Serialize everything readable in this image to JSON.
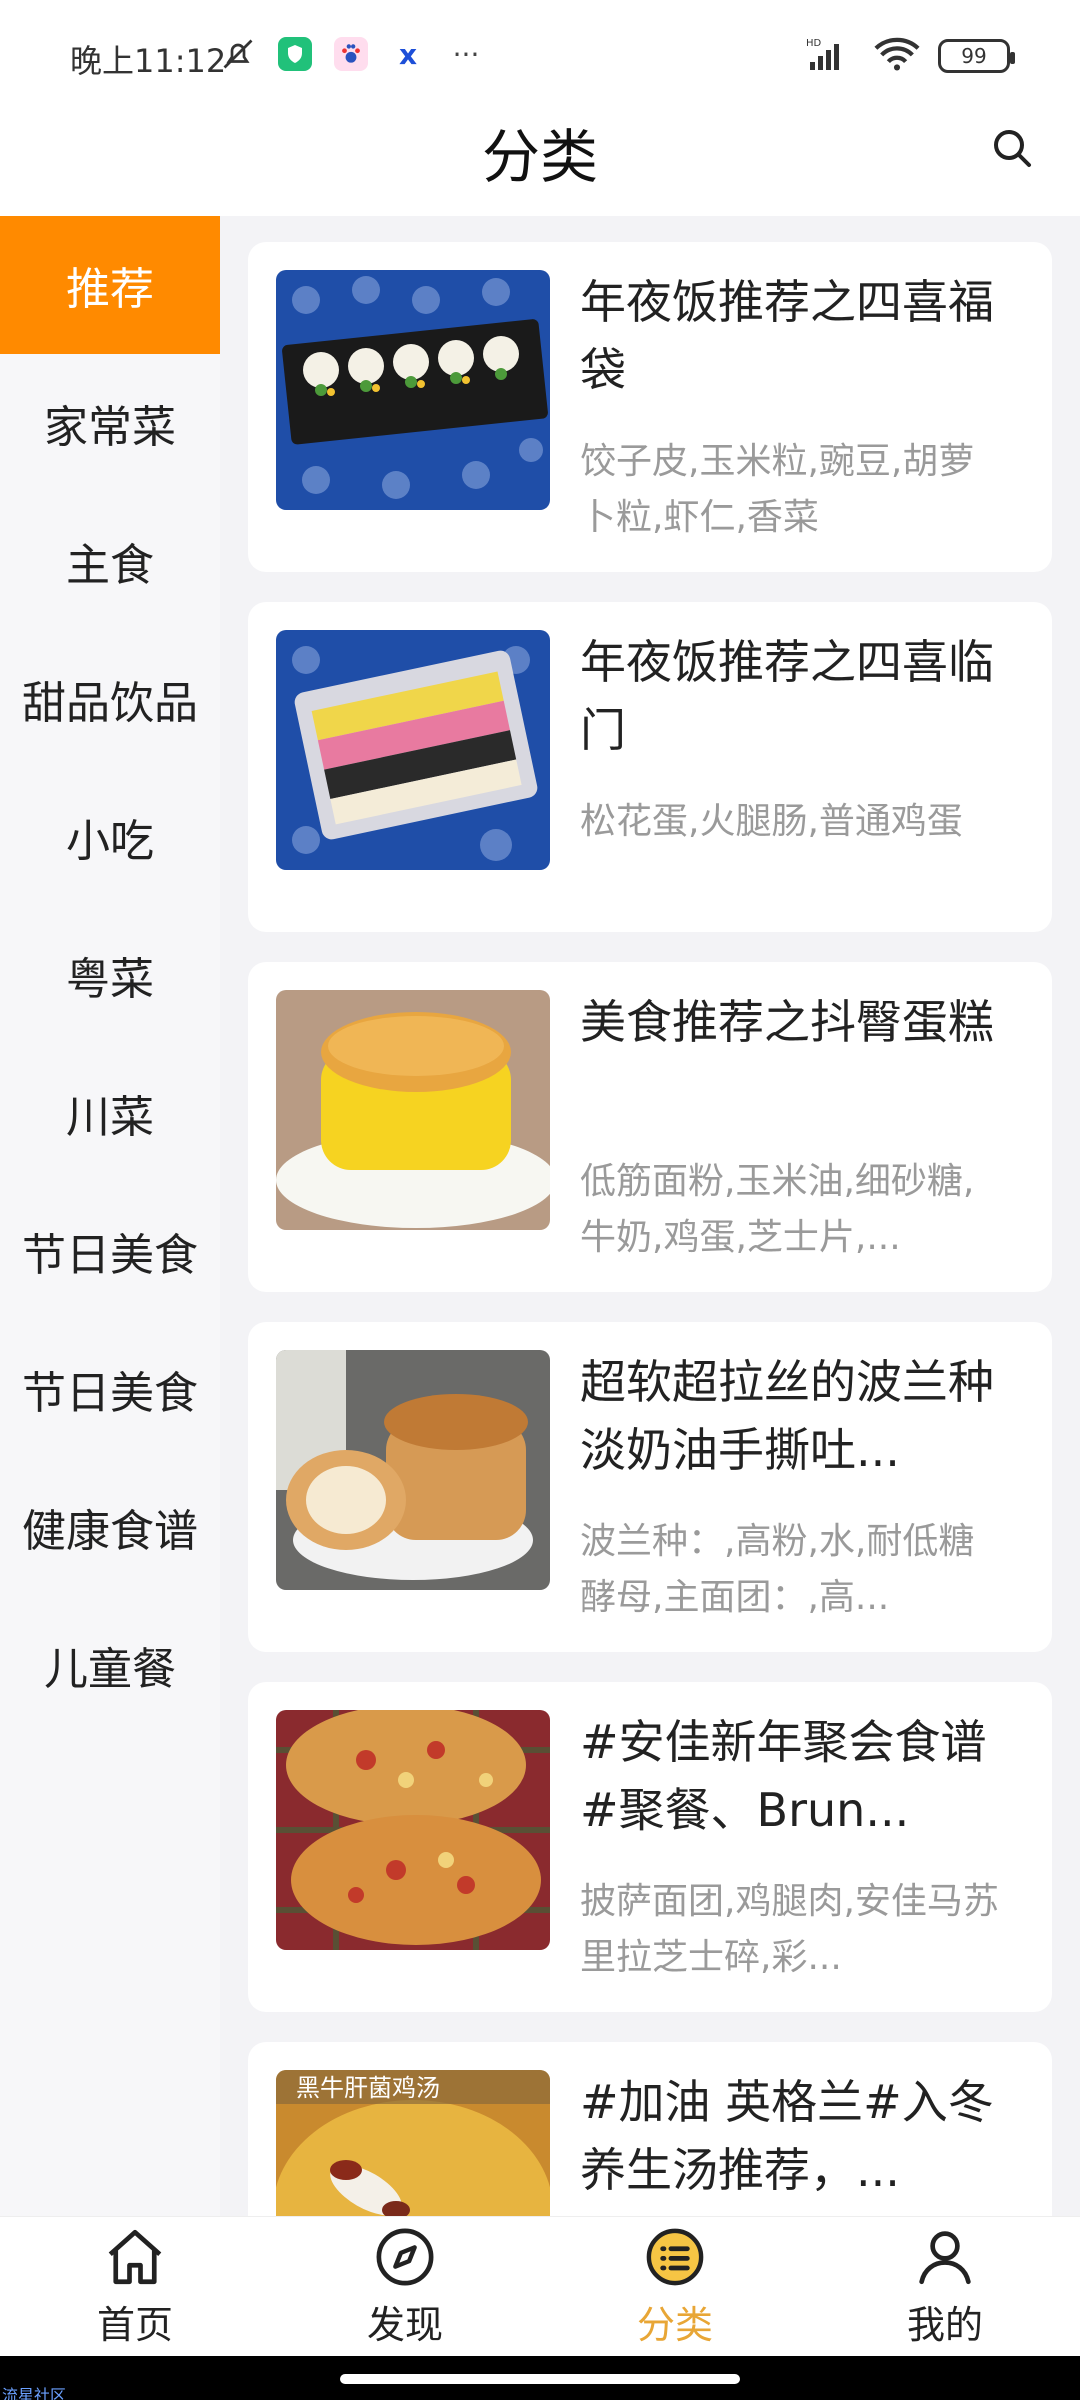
{
  "status_bar": {
    "time": "晚上11:12",
    "battery": "99",
    "more": "···"
  },
  "header": {
    "title": "分类"
  },
  "sidebar": {
    "items": [
      {
        "label": "推荐",
        "active": true
      },
      {
        "label": "家常菜"
      },
      {
        "label": "主食"
      },
      {
        "label": "甜品饮品"
      },
      {
        "label": "小吃"
      },
      {
        "label": "粤菜"
      },
      {
        "label": "川菜"
      },
      {
        "label": "节日美食"
      },
      {
        "label": "节日美食"
      },
      {
        "label": "健康食谱"
      },
      {
        "label": "儿童餐"
      }
    ]
  },
  "recipes": [
    {
      "title": "年夜饭推荐之四喜福袋",
      "desc": "饺子皮,玉米粒,豌豆,胡萝卜粒,虾仁,香菜"
    },
    {
      "title": "年夜饭推荐之四喜临门",
      "desc": "松花蛋,火腿肠,普通鸡蛋"
    },
    {
      "title": "美食推荐之抖臀蛋糕",
      "desc": "低筋面粉,玉米油,细砂糖,牛奶,鸡蛋,芝士片,..."
    },
    {
      "title": "超软超拉丝的波兰种淡奶油手撕吐...",
      "desc": "波兰种：,高粉,水,耐低糖酵母,主面团：,高..."
    },
    {
      "title": "#安佳新年聚会食谱#聚餐、Brun...",
      "desc": "披萨面团,鸡腿肉,安佳马苏里拉芝士碎,彩..."
    },
    {
      "title": "#加油 英格兰#入冬养生汤推荐，...",
      "desc": ""
    }
  ],
  "tabs": [
    {
      "label": "首页",
      "icon": "home-icon"
    },
    {
      "label": "发现",
      "icon": "compass-icon"
    },
    {
      "label": "分类",
      "icon": "category-icon",
      "active": true
    },
    {
      "label": "我的",
      "icon": "user-icon"
    }
  ],
  "image_overlay_text": "黑牛肝菌鸡汤",
  "watermark": "流星社区",
  "colors": {
    "accent": "#ff8a00",
    "tab_active": "#e8a636",
    "desc_gray": "#9a9a9a"
  }
}
